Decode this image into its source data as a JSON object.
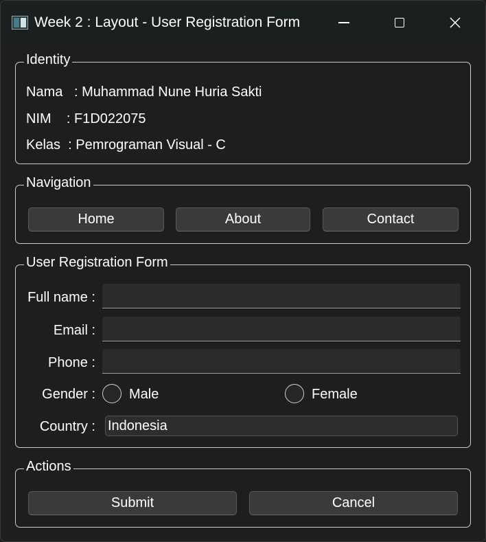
{
  "window": {
    "title": "Week 2 : Layout - User Registration Form"
  },
  "identity": {
    "group_title": "Identity",
    "nama": "Nama   : Muhammad Nune Huria Sakti",
    "nim": "NIM    : F1D022075",
    "kelas": "Kelas  : Pemrograman Visual - C"
  },
  "navigation": {
    "group_title": "Navigation",
    "home": "Home",
    "about": "About",
    "contact": "Contact"
  },
  "form": {
    "group_title": "User Registration Form",
    "full_name_label": "Full name :",
    "full_name_value": "",
    "email_label": "Email :",
    "email_value": "",
    "phone_label": "Phone :",
    "phone_value": "",
    "gender_label": "Gender :",
    "gender_male": "Male",
    "gender_female": "Female",
    "country_label": "Country :",
    "country_value": "Indonesia"
  },
  "actions": {
    "group_title": "Actions",
    "submit": "Submit",
    "cancel": "Cancel"
  },
  "icons": {
    "app": "app-window-icon",
    "minimize": "minimize-icon",
    "maximize": "maximize-icon",
    "close": "close-icon"
  }
}
